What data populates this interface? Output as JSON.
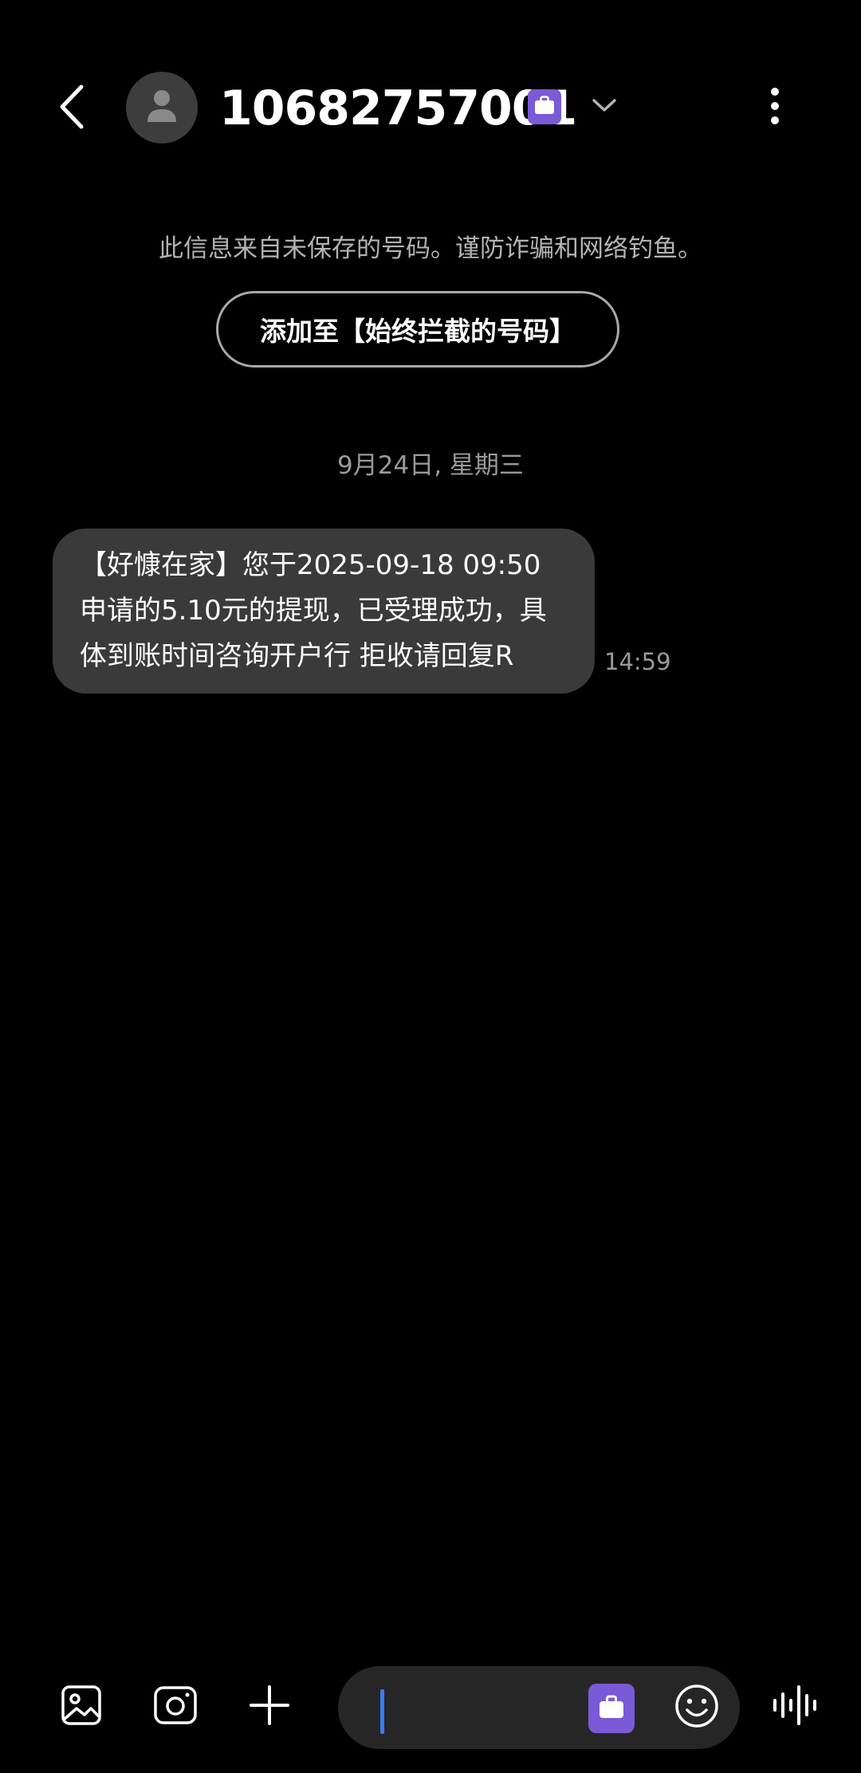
{
  "header": {
    "contact_number": "10682757001",
    "back_icon": "chevron-left-icon",
    "avatar_icon": "person-icon",
    "badge_icon": "briefcase-icon",
    "expand_icon": "chevron-down-icon",
    "more_icon": "more-vertical-icon"
  },
  "warning": {
    "text": "此信息来自未保存的号码。谨防诈骗和网络钓鱼。",
    "block_button_label": "添加至【始终拦截的号码】"
  },
  "conversation": {
    "date": "9月24日, 星期三",
    "messages": [
      {
        "text": "【好慷在家】您于2025-09-18 09:50申请的5.10元的提现，已受理成功，具体到账时间咨询开户行 拒收请回复R",
        "time": "14:59"
      }
    ]
  },
  "composer": {
    "input_value": "",
    "input_placeholder": "",
    "icons": [
      "image-icon",
      "camera-icon",
      "plus-icon",
      "briefcase-icon",
      "emoji-icon",
      "voice-wave-icon"
    ]
  },
  "colors": {
    "background": "#000000",
    "bubble": "#3a3a3a",
    "accent_purple": "#7a5ad6",
    "cursor_blue": "#3a7bf2",
    "secondary_text": "#9a9a9a"
  }
}
